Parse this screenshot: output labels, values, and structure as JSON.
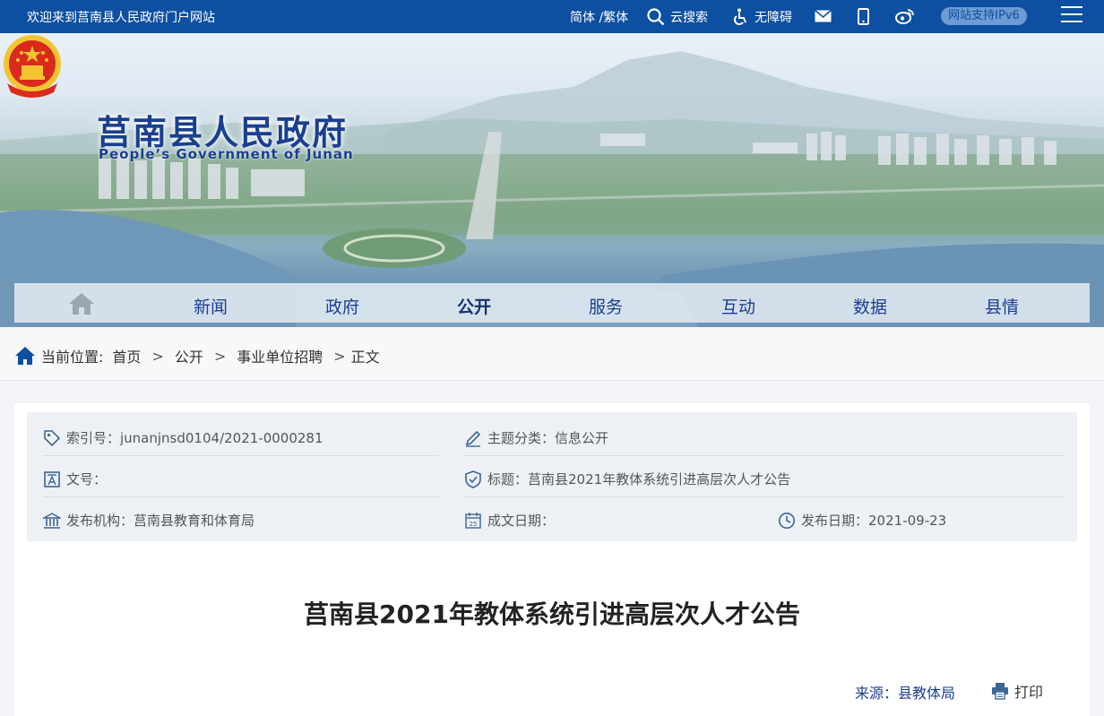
{
  "topbar": {
    "welcome": "欢迎来到莒南县人民政府门户网站",
    "lang": "简体 /繁体",
    "search": "云搜索",
    "accessibility": "无障碍",
    "ipv6": "网站支持IPv6"
  },
  "header": {
    "title": "莒南县人民政府",
    "subtitle": "People’s Government of Junan"
  },
  "nav": {
    "items": [
      {
        "label": "新闻"
      },
      {
        "label": "政府"
      },
      {
        "label": "公开"
      },
      {
        "label": "服务"
      },
      {
        "label": "互动"
      },
      {
        "label": "数据"
      },
      {
        "label": "县情"
      }
    ],
    "active": "公开"
  },
  "breadcrumb": {
    "prefix": "当前位置:",
    "items": [
      "首页",
      "公开",
      "事业单位招聘",
      "正文"
    ],
    "separator": ">"
  },
  "meta": {
    "index_no": "索引号：junanjnsd0104/2021-0000281",
    "topic": "主题分类：信息公开",
    "doc_no": "文号：",
    "title": "标题：莒南县2021年教体系统引进高层次人才公告",
    "publisher": "发布机构：莒南县教育和体育局",
    "written_date": "成文日期：",
    "publish_date_label": "发布日期：",
    "publish_date": "2021-09-23"
  },
  "article": {
    "title": "莒南县2021年教体系统引进高层次人才公告",
    "source": "来源：县教体局",
    "print": "打印"
  },
  "colors": {
    "brand": "#0d4fa0",
    "title_blue": "#1b3f8f"
  }
}
